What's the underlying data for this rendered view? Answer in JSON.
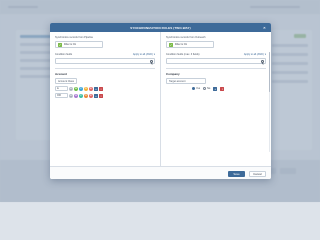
{
  "dialog": {
    "title": "SYNCHRONIZATION RULES (TWO-WAY)",
    "close_glyph": "×",
    "save_label": "Save",
    "cancel_label": "Cancel"
  },
  "left": {
    "sync_label": "Synchronize records from Pipeline",
    "filter_label": "Filter is On",
    "condition_label": "Condition fields",
    "apply_label": "Apply to all (AND)",
    "object_name": "Account",
    "field_name": "Account Class",
    "operator_1": "is",
    "operator_2": "OR",
    "chips": [
      "A",
      "B",
      "C",
      "D",
      "E"
    ],
    "chips_row2": [
      "A",
      "B",
      "C",
      "D",
      "E"
    ]
  },
  "right": {
    "sync_label": "Synchronize records from Outreach",
    "filter_label": "Filter is On",
    "condition_label": "Condition fields (max. 3 fields)",
    "apply_label": "Apply to all (AND)",
    "object_name": "Company",
    "field_name": "Target account",
    "yes_label": "Yes",
    "no_label": "No"
  },
  "colors": {
    "header": "#3d6a99",
    "filter_on": "#7dbb4b",
    "delete": "#c9464a"
  },
  "icons": [
    "check-icon",
    "search-icon",
    "chevron-down-icon",
    "plus-icon",
    "trash-icon",
    "close-icon"
  ]
}
